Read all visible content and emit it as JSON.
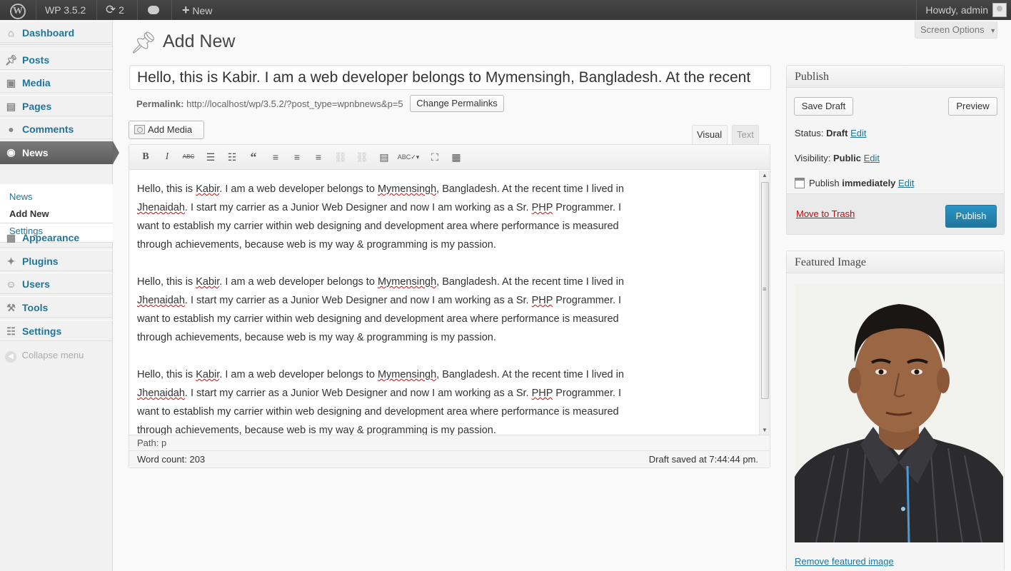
{
  "admin_bar": {
    "site_name": "WP 3.5.2",
    "updates_count": "2",
    "new_label": "New",
    "howdy": "Howdy, admin"
  },
  "sidebar": {
    "items": [
      {
        "label": "Dashboard",
        "icon": "dashboard-icon"
      },
      {
        "label": "Posts",
        "icon": "pin-icon"
      },
      {
        "label": "Media",
        "icon": "media-icon"
      },
      {
        "label": "Pages",
        "icon": "pages-icon"
      },
      {
        "label": "Comments",
        "icon": "comment-icon"
      },
      {
        "label": "News",
        "icon": "news-icon"
      },
      {
        "label": "Appearance",
        "icon": "appearance-icon"
      },
      {
        "label": "Plugins",
        "icon": "plugin-icon"
      },
      {
        "label": "Users",
        "icon": "users-icon"
      },
      {
        "label": "Tools",
        "icon": "tools-icon"
      },
      {
        "label": "Settings",
        "icon": "settings-icon"
      }
    ],
    "submenu": [
      "News",
      "Add New",
      "Settings"
    ],
    "collapse_label": "Collapse menu"
  },
  "screen_options": "Screen Options",
  "page_title": "Add New",
  "post": {
    "title_value": "Hello, this is Kabir. I am a web developer belongs to Mymensingh, Bangladesh. At the recent",
    "permalink_label": "Permalink:",
    "permalink_url": "http://localhost/wp/3.5.2/?post_type=wpnbnews&p=5",
    "change_permalinks": "Change Permalinks",
    "add_media": "Add Media",
    "tab_visual": "Visual",
    "tab_text": "Text",
    "paragraph": {
      "s1": "Hello, this is ",
      "w1": "Kabir",
      "s2": ". I am a web developer belongs to ",
      "w2": "Mymensingh",
      "s3": ", Bangladesh. At the recent time I lived in ",
      "w3": "Jhenaidah",
      "s4": ". I start my carrier as a Junior Web Designer and now I am working as a Sr. ",
      "w4": "PHP",
      "s5": " Programmer. I want to establish my carrier within web designing and development area where performance is measured through achievements, because web is my way & programming is my passion."
    },
    "path": "Path: p",
    "word_count": "Word count: 203",
    "draft_saved": "Draft saved at 7:44:44 pm."
  },
  "publish": {
    "heading": "Publish",
    "save_draft": "Save Draft",
    "preview": "Preview",
    "status_label": "Status:",
    "status_value": "Draft",
    "visibility_label": "Visibility:",
    "visibility_value": "Public",
    "publish_label": "Publish",
    "publish_value": "immediately",
    "edit": "Edit",
    "move_to_trash": "Move to Trash",
    "publish_button": "Publish"
  },
  "featured_image": {
    "heading": "Featured Image",
    "remove_link": "Remove featured image"
  }
}
